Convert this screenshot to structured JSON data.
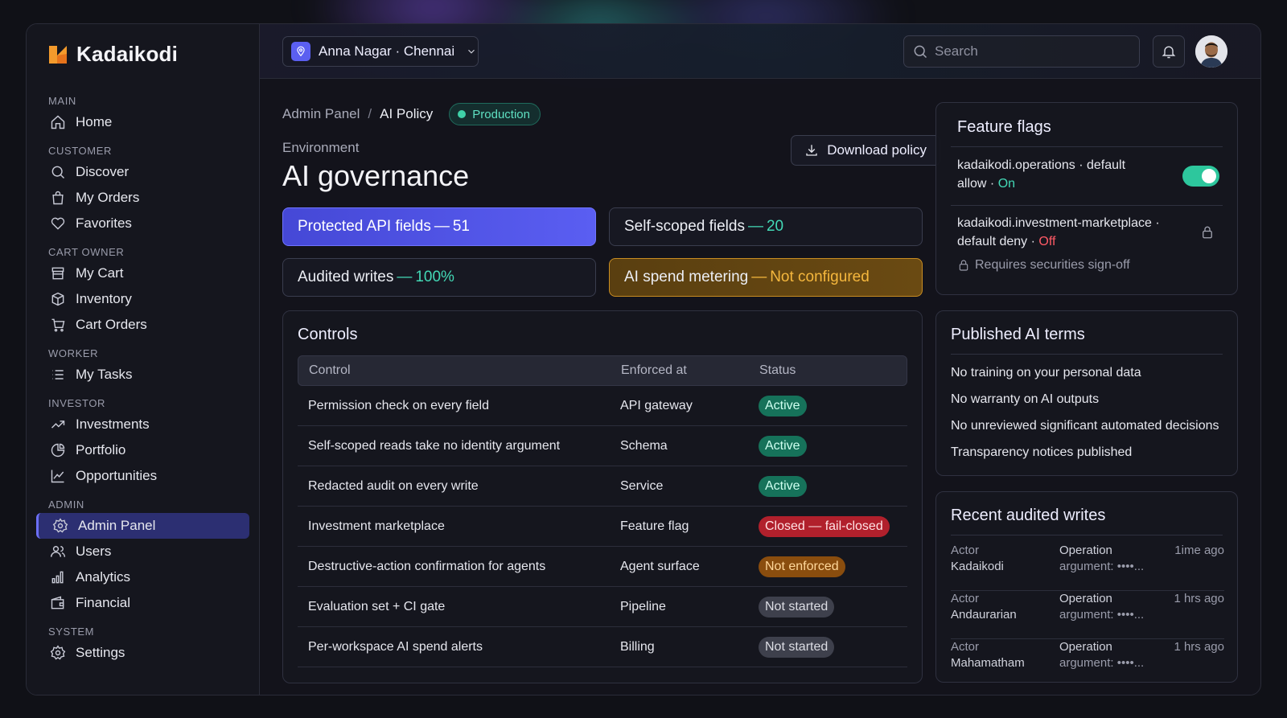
{
  "app": {
    "name": "Kadaikodi"
  },
  "sidebar": {
    "sections": [
      {
        "label": "MAIN",
        "items": [
          {
            "label": "Home",
            "icon": "home-icon"
          }
        ]
      },
      {
        "label": "CUSTOMER",
        "items": [
          {
            "label": "Discover",
            "icon": "search-icon"
          },
          {
            "label": "My Orders",
            "icon": "bag-icon"
          },
          {
            "label": "Favorites",
            "icon": "heart-icon"
          }
        ]
      },
      {
        "label": "CART OWNER",
        "items": [
          {
            "label": "My Cart",
            "icon": "store-icon"
          },
          {
            "label": "Inventory",
            "icon": "box-icon"
          },
          {
            "label": "Cart Orders",
            "icon": "cart-icon"
          }
        ]
      },
      {
        "label": "WORKER",
        "items": [
          {
            "label": "My Tasks",
            "icon": "list-icon"
          }
        ]
      },
      {
        "label": "INVESTOR",
        "items": [
          {
            "label": "Investments",
            "icon": "trend-icon"
          },
          {
            "label": "Portfolio",
            "icon": "pie-icon"
          },
          {
            "label": "Opportunities",
            "icon": "chart-line-icon"
          }
        ]
      },
      {
        "label": "ADMIN",
        "items": [
          {
            "label": "Admin Panel",
            "icon": "gear-icon",
            "active": true
          },
          {
            "label": "Users",
            "icon": "users-icon"
          },
          {
            "label": "Analytics",
            "icon": "bar-chart-icon"
          },
          {
            "label": "Financial",
            "icon": "wallet-icon"
          }
        ]
      },
      {
        "label": "SYSTEM",
        "items": [
          {
            "label": "Settings",
            "icon": "gear-icon"
          }
        ]
      }
    ]
  },
  "topbar": {
    "location": "Anna Nagar · Chennai",
    "search_placeholder": "Search"
  },
  "breadcrumb": {
    "root": "Admin Panel",
    "sep": "/",
    "current": "AI Policy",
    "badge": "Production"
  },
  "header": {
    "env_label": "Environment",
    "title": "AI governance",
    "download_label": "Download policy"
  },
  "stats": {
    "s1": {
      "label": "Protected API fields",
      "dash": "—",
      "value": "51"
    },
    "s2": {
      "label": "Self-scoped fields",
      "dash": "—",
      "value": "20"
    },
    "s3": {
      "label": "Audited writes",
      "dash": "—",
      "value": "100%"
    },
    "s4": {
      "label": "AI spend metering",
      "dash": "—",
      "value": "Not configured"
    }
  },
  "controls": {
    "title": "Controls",
    "columns": [
      "Control",
      "Enforced at",
      "Status"
    ],
    "rows": [
      {
        "control": "Permission check on every field",
        "enforced": "API gateway",
        "status": "Active",
        "tone": "green"
      },
      {
        "control": "Self-scoped reads take no identity argument",
        "enforced": "Schema",
        "status": "Active",
        "tone": "green"
      },
      {
        "control": "Redacted audit on every write",
        "enforced": "Service",
        "status": "Active",
        "tone": "green"
      },
      {
        "control": "Investment marketplace",
        "enforced": "Feature flag",
        "status": "Closed — fail-closed",
        "tone": "red"
      },
      {
        "control": "Destructive-action confirmation for agents",
        "enforced": "Agent surface",
        "status": "Not enforced",
        "tone": "orange"
      },
      {
        "control": "Evaluation set + CI gate",
        "enforced": "Pipeline",
        "status": "Not started",
        "tone": "gray"
      },
      {
        "control": "Per-workspace AI spend alerts",
        "enforced": "Billing",
        "status": "Not started",
        "tone": "gray"
      }
    ]
  },
  "flags": {
    "title": "Feature flags",
    "f1": {
      "line1": "kadaikodi.operations · default",
      "line2": "allow · ",
      "state": "On",
      "enabled": true
    },
    "f2": {
      "line1": "kadaikodi.investment-marketplace ·",
      "line2": "default deny · ",
      "state": "Off",
      "locked": true
    },
    "signoff": "Requires securities sign-off"
  },
  "terms": {
    "title": "Published AI terms",
    "items": [
      "No training on your personal data",
      "No warranty on AI outputs",
      "No unreviewed significant automated decisions",
      "Transparency notices published"
    ]
  },
  "writes": {
    "title": "Recent audited writes",
    "rows": [
      {
        "actor_label": "Actor",
        "actor": "Kadaikodi",
        "op": "Operation",
        "arg": "argument: ••••...",
        "time": "1ime ago"
      },
      {
        "actor_label": "Actor",
        "actor": "Andaurarian",
        "op": "Operation",
        "arg": "argument: ••••...",
        "time": "1 hrs ago"
      },
      {
        "actor_label": "Actor",
        "actor": "Mahamatham",
        "op": "Operation",
        "arg": "argument: ••••...",
        "time": "1 hrs ago"
      }
    ]
  },
  "colors": {
    "accent": "#5a5ef2",
    "teal": "#43d9b6",
    "amber": "#f5b73d",
    "danger": "#ff5a66"
  }
}
